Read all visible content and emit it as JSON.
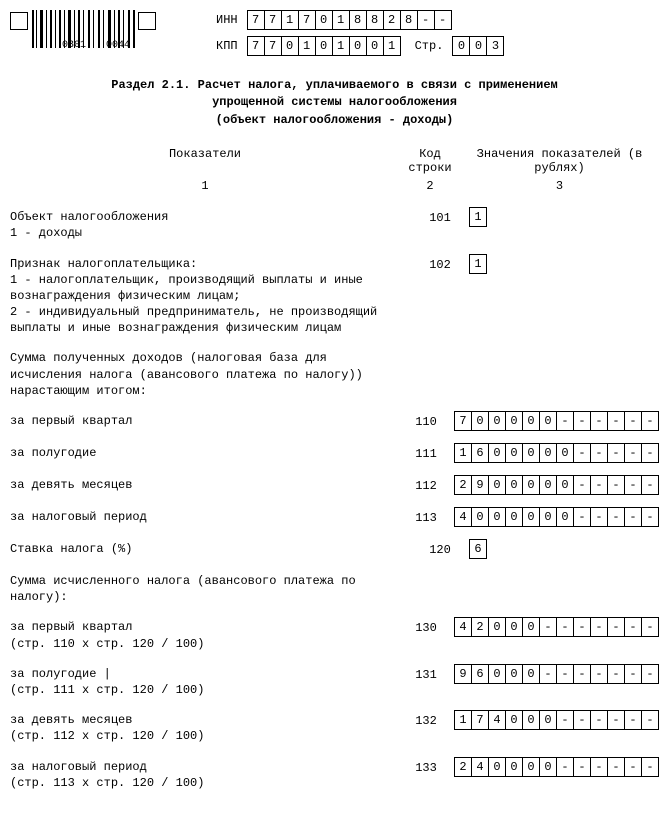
{
  "header": {
    "inn_label": "ИНН",
    "inn": [
      "7",
      "7",
      "1",
      "7",
      "0",
      "1",
      "8",
      "8",
      "2",
      "8",
      "-",
      "-"
    ],
    "kpp_label": "КПП",
    "kpp": [
      "7",
      "7",
      "0",
      "1",
      "0",
      "1",
      "0",
      "0",
      "1"
    ],
    "page_label": "Стр.",
    "page": [
      "0",
      "0",
      "3"
    ],
    "barcode_left": "0301",
    "barcode_right": "0044"
  },
  "title": {
    "l1": "Раздел 2.1. Расчет налога, уплачиваемого в связи с применением",
    "l2": "упрощенной системы налогообложения",
    "l3": "(объект налогообложения - доходы)"
  },
  "columns": {
    "h1": "Показатели",
    "h2": "Код строки",
    "h3": "Значения показателей (в рублях)",
    "s1": "1",
    "s2": "2",
    "s3": "3"
  },
  "rows": {
    "r101_desc": "Объект налогообложения\n1 - доходы",
    "r101_code": "101",
    "r101_val": [
      "1"
    ],
    "r102_desc": "Признак налогоплательщика:\n1 - налогоплательщик, производящий выплаты и иные вознаграждения физическим лицам;\n2 - индивидуальный предприниматель, не производящий выплаты и иные вознаграждения физическим лицам",
    "r102_code": "102",
    "r102_val": [
      "1"
    ],
    "note_income": "Сумма полученных доходов (налоговая база для исчисления налога (авансового платежа по налогу)) нарастающим итогом:",
    "r110_desc": "за первый квартал",
    "r110_code": "110",
    "r110_val": [
      "7",
      "0",
      "0",
      "0",
      "0",
      "0",
      "-",
      "-",
      "-",
      "-",
      "-",
      "-"
    ],
    "r111_desc": "за полугодие",
    "r111_code": "111",
    "r111_val": [
      "1",
      "6",
      "0",
      "0",
      "0",
      "0",
      "0",
      "-",
      "-",
      "-",
      "-",
      "-"
    ],
    "r112_desc": "за девять месяцев",
    "r112_code": "112",
    "r112_val": [
      "2",
      "9",
      "0",
      "0",
      "0",
      "0",
      "0",
      "-",
      "-",
      "-",
      "-",
      "-"
    ],
    "r113_desc": "за налоговый период",
    "r113_code": "113",
    "r113_val": [
      "4",
      "0",
      "0",
      "0",
      "0",
      "0",
      "0",
      "-",
      "-",
      "-",
      "-",
      "-"
    ],
    "r120_desc": "Ставка налога (%)",
    "r120_code": "120",
    "r120_val": [
      "6"
    ],
    "note_tax": "Сумма исчисленного налога (авансового платежа по налогу):",
    "r130_desc": "за первый квартал\n(стр. 110 x стр. 120 / 100)",
    "r130_code": "130",
    "r130_val": [
      "4",
      "2",
      "0",
      "0",
      "0",
      "-",
      "-",
      "-",
      "-",
      "-",
      "-",
      "-"
    ],
    "r131_desc": "за полугодие                   |\n(стр. 111 x стр. 120 / 100)",
    "r131_code": "131",
    "r131_val": [
      "9",
      "6",
      "0",
      "0",
      "0",
      "-",
      "-",
      "-",
      "-",
      "-",
      "-",
      "-"
    ],
    "r132_desc": "за девять месяцев\n(стр. 112 x стр. 120 / 100)",
    "r132_code": "132",
    "r132_val": [
      "1",
      "7",
      "4",
      "0",
      "0",
      "0",
      "-",
      "-",
      "-",
      "-",
      "-",
      "-"
    ],
    "r133_desc": "за налоговый период\n(стр. 113 x стр. 120 / 100)",
    "r133_code": "133",
    "r133_val": [
      "2",
      "4",
      "0",
      "0",
      "0",
      "0",
      "-",
      "-",
      "-",
      "-",
      "-",
      "-"
    ]
  }
}
